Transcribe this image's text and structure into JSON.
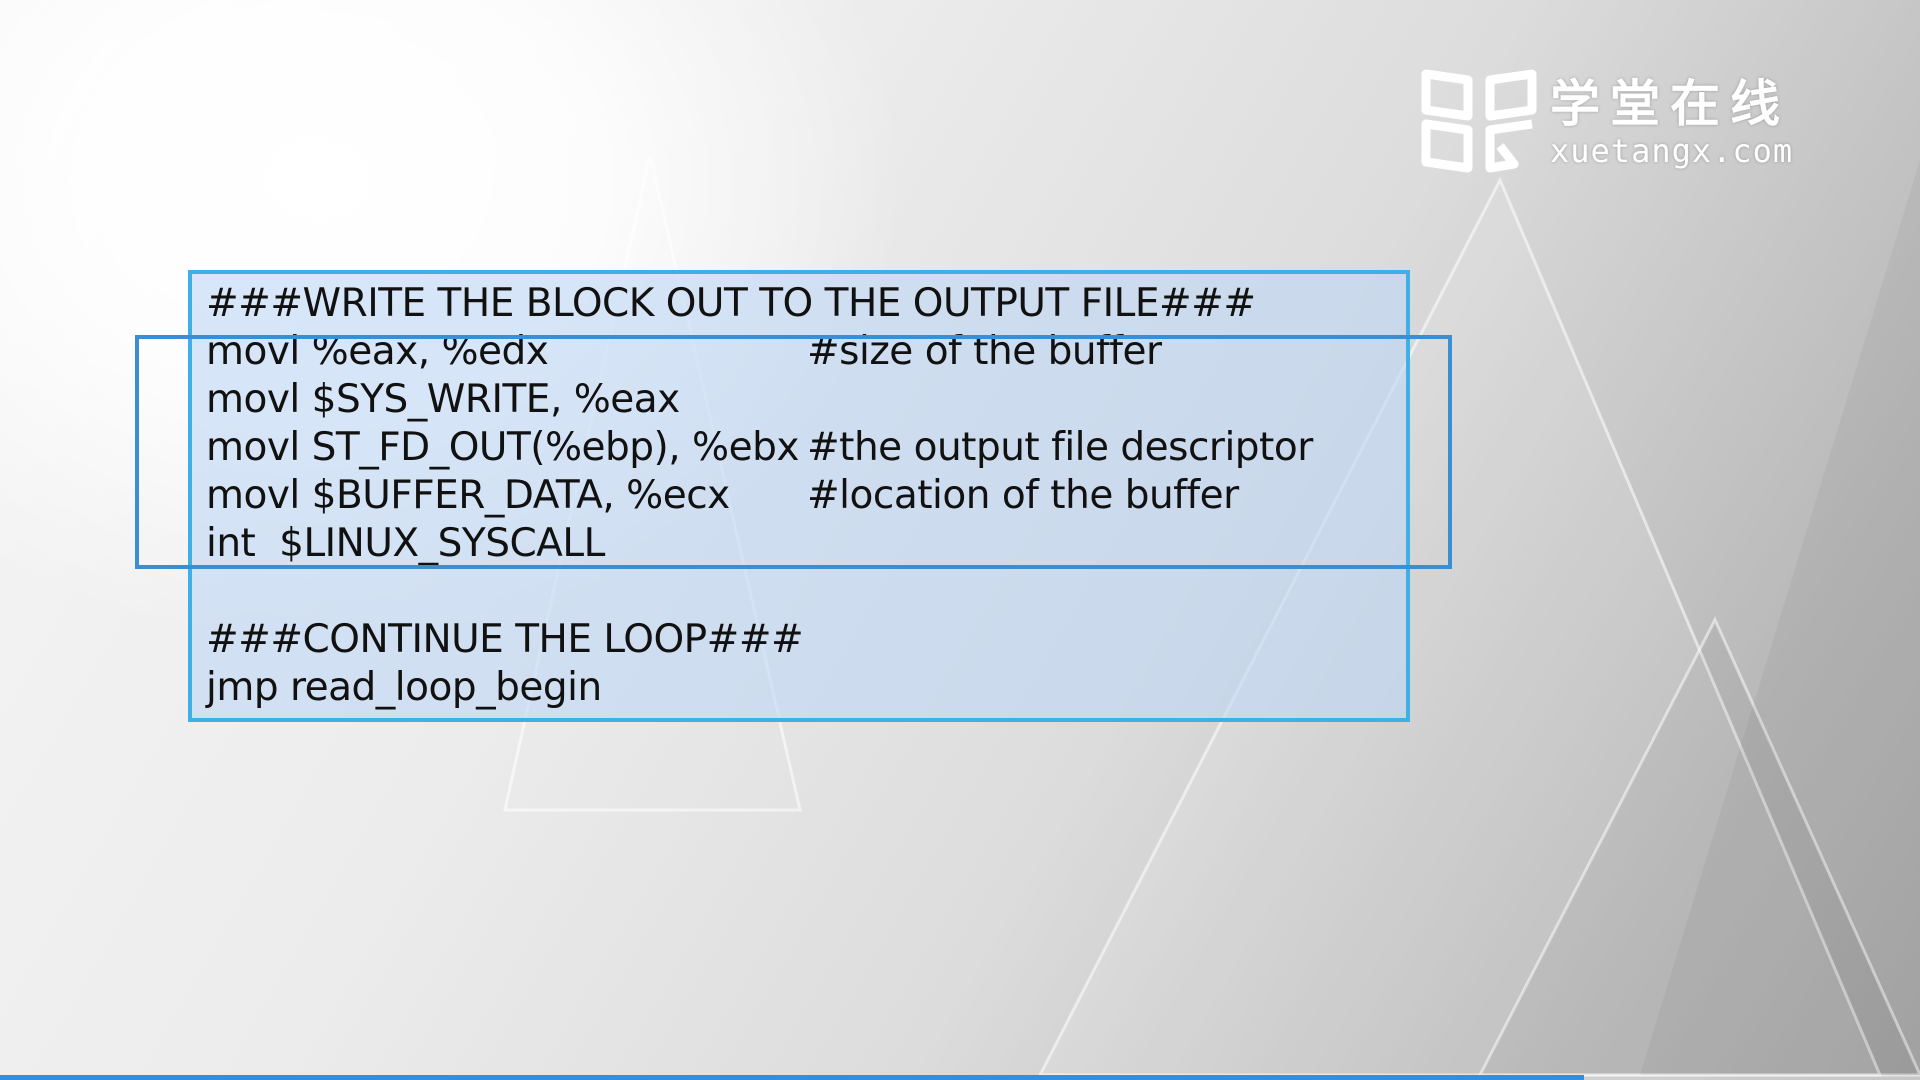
{
  "logo": {
    "icon": "book-icon",
    "chinese_name": "学堂在线",
    "domain": "xuetangx.com"
  },
  "code": {
    "lines": [
      {
        "instruction": "###WRITE THE BLOCK OUT TO THE OUTPUT FILE###",
        "comment": ""
      },
      {
        "instruction": "movl %eax, %edx",
        "comment": "#size of the buffer"
      },
      {
        "instruction": "movl $SYS_WRITE, %eax",
        "comment": ""
      },
      {
        "instruction": "movl ST_FD_OUT(%ebp), %ebx",
        "comment": "#the output file descriptor"
      },
      {
        "instruction": "movl $BUFFER_DATA, %ecx",
        "comment": "#location of the buffer"
      },
      {
        "instruction": "int  $LINUX_SYSCALL",
        "comment": ""
      },
      {
        "instruction": "",
        "comment": ""
      },
      {
        "instruction": "###CONTINUE THE LOOP###",
        "comment": ""
      },
      {
        "instruction": "jmp read_loop_begin",
        "comment": ""
      }
    ]
  },
  "player": {
    "progress_fraction": 0.825
  },
  "colors": {
    "panel_border": "#3fb0e6",
    "highlight_border": "#3a8fd4",
    "progress": "#2f8fe0"
  }
}
